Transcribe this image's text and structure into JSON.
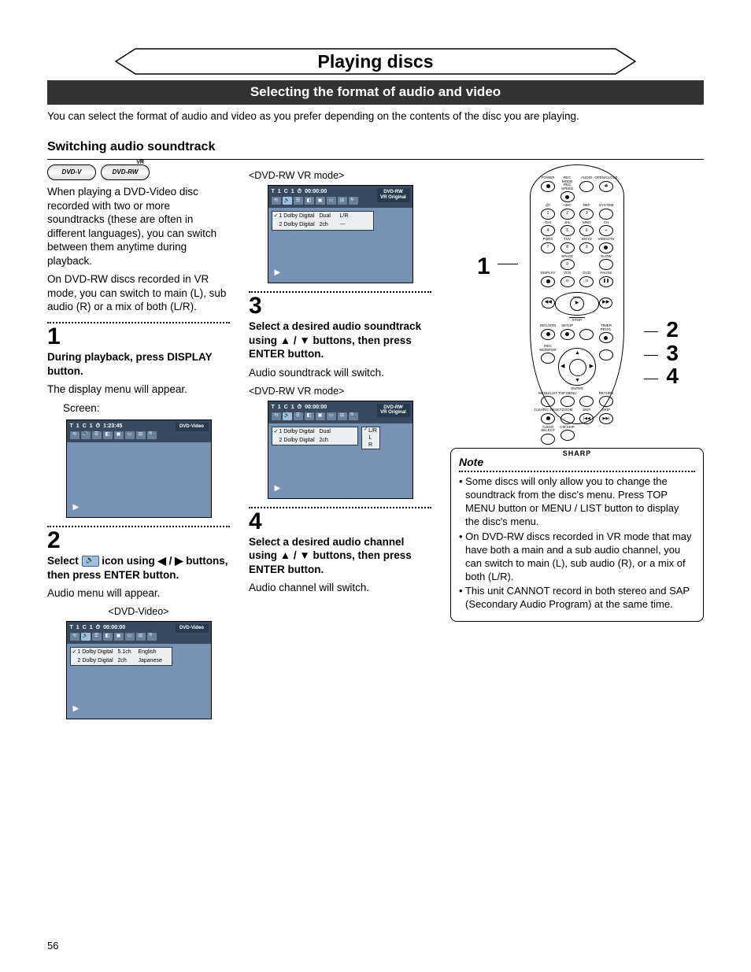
{
  "page_number": "56",
  "title": "Playing discs",
  "subtitle": "Selecting the format of audio and video",
  "intro": "You can select the format of audio and video as you prefer depending on the contents of the disc you are playing.",
  "heading1": "Switching audio soundtrack",
  "badges": {
    "b1": "DVD-V",
    "b1_sub": "",
    "b2": "DVD-RW",
    "b2_sup": "VR"
  },
  "para1": "When playing a DVD-Video disc recorded with two or more soundtracks (these are often in different languages), you can switch between them anytime during playback.",
  "para1b": "On DVD-RW discs recorded in VR mode, you can switch to main (L), sub audio (R) or a mix of both (L/R).",
  "step1": {
    "num": "1",
    "bold": "During playback, press DISPLAY button.",
    "plain": "The display menu will appear.",
    "screen_label": "Screen:"
  },
  "step2": {
    "num": "2",
    "bold_a": "Select ",
    "bold_b": " icon using ◀ / ▶ buttons, then press ENTER button.",
    "plain": "Audio menu will appear.",
    "label": "<DVD-Video>"
  },
  "mid_label_top": "<DVD-RW VR mode>",
  "step3": {
    "num": "3",
    "bold": "Select a desired audio soundtrack using ▲ / ▼ buttons, then press ENTER button.",
    "plain": "Audio soundtrack will switch.",
    "label": "<DVD-RW VR mode>"
  },
  "step4": {
    "num": "4",
    "bold": "Select a desired audio channel using ▲ / ▼ buttons, then press ENTER button.",
    "plain": "Audio channel will switch."
  },
  "osd_common": {
    "title_icon": "T",
    "chapter_icon": "C",
    "track1": "1",
    "track2": "1",
    "play_glyph": "▶"
  },
  "osd1": {
    "time": "1:23:45",
    "tag": "DVD-Video"
  },
  "osd2": {
    "time": "00:00:00",
    "tag": "DVD-Video",
    "rows": [
      [
        "1 Dolby Digital",
        "5.1ch",
        "English"
      ],
      [
        "2 Dolby Digital",
        "2ch",
        "Japanese"
      ]
    ]
  },
  "osd3": {
    "time": "00:00:00",
    "tag1": "DVD-RW",
    "tag2": "VR Original",
    "rows": [
      [
        "1 Dolby Digital",
        "Dual",
        "L/R"
      ],
      [
        "2 Dolby Digital",
        "2ch",
        "---"
      ]
    ]
  },
  "osd4": {
    "time": "00:00:00",
    "tag1": "DVD-RW",
    "tag2": "VR Original",
    "rows": [
      [
        "1 Dolby Digital",
        "Dual"
      ],
      [
        "2 Dolby Digital",
        "2ch"
      ]
    ],
    "dropdown": [
      "L/R",
      "L",
      "R"
    ]
  },
  "remote": {
    "callout_left": "1",
    "callouts_right": [
      "2",
      "3",
      "4"
    ],
    "row_labels": {
      "r1": [
        "POWER",
        "REC MODE REC SPEED",
        "AUDIO",
        "OPEN/CLOSE"
      ],
      "r2": [
        "@!",
        "ABC",
        "DEF",
        ""
      ],
      "r2n": [
        "1",
        "2",
        "3",
        "SYSTEM"
      ],
      "r3": [
        "GHI",
        "JKL",
        "MNO",
        "CH"
      ],
      "r3n": [
        "4",
        "5",
        "6",
        "+"
      ],
      "r4": [
        "PQRS",
        "TUV",
        "WXYZ",
        "VIDEO/TV"
      ],
      "r4n": [
        "7",
        "8",
        "9",
        ""
      ],
      "r5": [
        "",
        "SPACE",
        "",
        "SLOW"
      ],
      "r5n": [
        "",
        "0",
        "",
        ""
      ],
      "r6": [
        "DISPLAY",
        "VCR",
        "DVD",
        "PAUSE"
      ],
      "play": "PLAY",
      "stop": "STOP",
      "r7": [
        "REC/OTR",
        "SETUP",
        "",
        "TIMER PROG."
      ],
      "r8": [
        "REC MONITOR",
        "",
        "ENTER",
        ""
      ],
      "r9": [
        "MENU/LIST",
        "TOP MENU",
        "",
        "RETURN"
      ],
      "r10": [
        "CLEAR/C.RESET",
        "ZOOM",
        "SKIP",
        "SKIP"
      ],
      "r11": [
        "AUDIO SELECT",
        "CM SKIP",
        "",
        ""
      ]
    },
    "brand": "SHARP"
  },
  "note": {
    "head": "Note",
    "items": [
      "Some discs will only allow you to change the soundtrack from the disc's menu. Press TOP MENU button or MENU / LIST button to display the disc's menu.",
      "On DVD-RW discs recorded in VR mode that may have both a main and a sub audio channel, you can switch to main (L), sub audio (R), or a mix of both (L/R).",
      "This unit CANNOT record in both stereo and SAP (Secondary Audio Program) at the same time."
    ]
  }
}
